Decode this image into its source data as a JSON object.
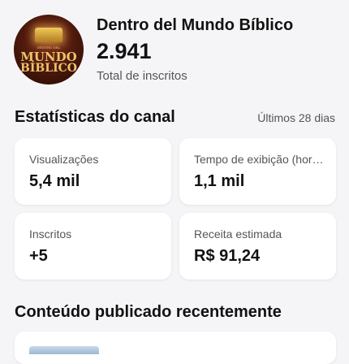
{
  "channel": {
    "name": "Dentro del Mundo Bíblico",
    "subscribers": "2.941",
    "subscribers_label": "Total de inscritos",
    "avatar_text": {
      "small": "DENTRO DEL",
      "line1": "MUNDO",
      "line2": "BÍBLICO"
    }
  },
  "stats": {
    "title": "Estatísticas do canal",
    "period": "Últimos 28 dias",
    "cards": [
      {
        "label": "Visualizações",
        "value": "5,4 mil"
      },
      {
        "label": "Tempo de exibição (hor…",
        "value": "1,1 mil"
      },
      {
        "label": "Inscritos",
        "value": "+5"
      },
      {
        "label": "Receita estimada",
        "value": "R$ 91,24"
      }
    ]
  },
  "recent": {
    "title": "Conteúdo publicado recentemente"
  }
}
